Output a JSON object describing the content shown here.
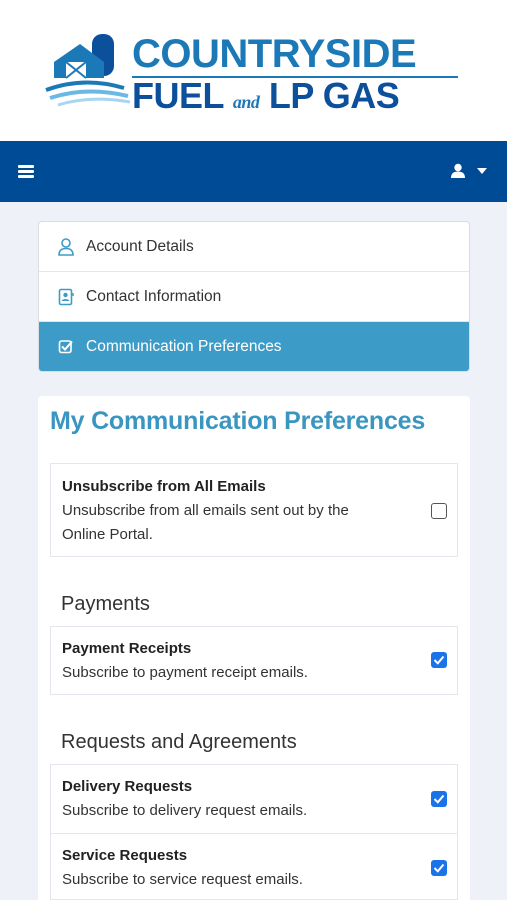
{
  "brand": {
    "line1": "COUNTRYSIDE",
    "line2a": "FUEL",
    "line2_and": "and",
    "line2b": "LP GAS",
    "colors": {
      "light_blue": "#1b79b8",
      "dark_blue": "#0c4f9a"
    }
  },
  "navbar": {
    "color": "#004b96",
    "menu_icon": "hamburger-icon",
    "user_icon": "user-icon"
  },
  "menu": {
    "items": [
      {
        "label": "Account Details",
        "icon": "user-outline-icon"
      },
      {
        "label": "Contact Information",
        "icon": "contact-card-icon"
      },
      {
        "label": "Communication Preferences",
        "icon": "checkbox-icon",
        "active": true
      }
    ],
    "active_color": "#3d9cc7"
  },
  "page": {
    "title": "My Communication Preferences",
    "unsubscribe": {
      "title": "Unsubscribe from All Emails",
      "desc_line1": "Unsubscribe from all emails sent out by the",
      "desc_line2": "Online Portal.",
      "checked": false
    },
    "sections": [
      {
        "heading": "Payments",
        "items": [
          {
            "title": "Payment Receipts",
            "desc": "Subscribe to payment receipt emails.",
            "checked": true
          }
        ]
      },
      {
        "heading": "Requests and Agreements",
        "items": [
          {
            "title": "Delivery Requests",
            "desc": "Subscribe to delivery request emails.",
            "checked": true
          },
          {
            "title": "Service Requests",
            "desc": "Subscribe to service request emails.",
            "checked": true
          }
        ]
      }
    ]
  }
}
